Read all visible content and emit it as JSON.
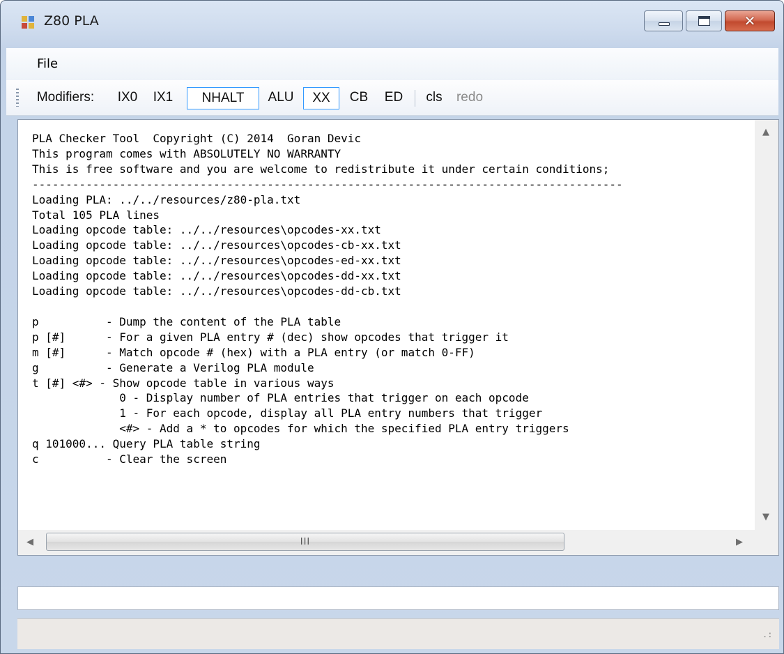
{
  "window": {
    "title": "Z80 PLA",
    "close_glyph": "✕",
    "icon": "windows-app-icon"
  },
  "menu": {
    "items": [
      {
        "label": "File"
      }
    ]
  },
  "toolbar": {
    "label": "Modifiers:",
    "buttons": [
      {
        "label": "IX0",
        "checked": false
      },
      {
        "label": "IX1",
        "checked": false
      },
      {
        "label": "NHALT",
        "checked": true
      },
      {
        "label": "ALU",
        "checked": false
      },
      {
        "label": "XX",
        "checked": true
      },
      {
        "label": "CB",
        "checked": false
      },
      {
        "label": "ED",
        "checked": false
      },
      {
        "label": "cls",
        "enabled": true
      },
      {
        "label": "redo",
        "enabled": false
      }
    ]
  },
  "output": {
    "lines": [
      "PLA Checker Tool  Copyright (C) 2014  Goran Devic",
      "This program comes with ABSOLUTELY NO WARRANTY",
      "This is free software and you are welcome to redistribute it under certain conditions;",
      "----------------------------------------------------------------------------------------",
      "Loading PLA: ../../resources/z80-pla.txt",
      "Total 105 PLA lines",
      "Loading opcode table: ../../resources\\opcodes-xx.txt",
      "Loading opcode table: ../../resources\\opcodes-cb-xx.txt",
      "Loading opcode table: ../../resources\\opcodes-ed-xx.txt",
      "Loading opcode table: ../../resources\\opcodes-dd-xx.txt",
      "Loading opcode table: ../../resources\\opcodes-dd-cb.txt",
      "",
      "p          - Dump the content of the PLA table",
      "p [#]      - For a given PLA entry # (dec) show opcodes that trigger it",
      "m [#]      - Match opcode # (hex) with a PLA entry (or match 0-FF)",
      "g          - Generate a Verilog PLA module",
      "t [#] <#> - Show opcode table in various ways",
      "             0 - Display number of PLA entries that trigger on each opcode",
      "             1 - For each opcode, display all PLA entry numbers that trigger",
      "             <#> - Add a * to opcodes for which the specified PLA entry triggers",
      "q 101000... Query PLA table string",
      "c          - Clear the screen"
    ]
  },
  "scrollbars": {
    "up_arrow": "▲",
    "down_arrow": "▼",
    "left_arrow": "◀",
    "right_arrow": "▶",
    "thumb_grip": "III"
  },
  "command_input": {
    "value": "",
    "placeholder": ""
  },
  "status_bar": {
    "text": "",
    "size_grip": ".:"
  }
}
